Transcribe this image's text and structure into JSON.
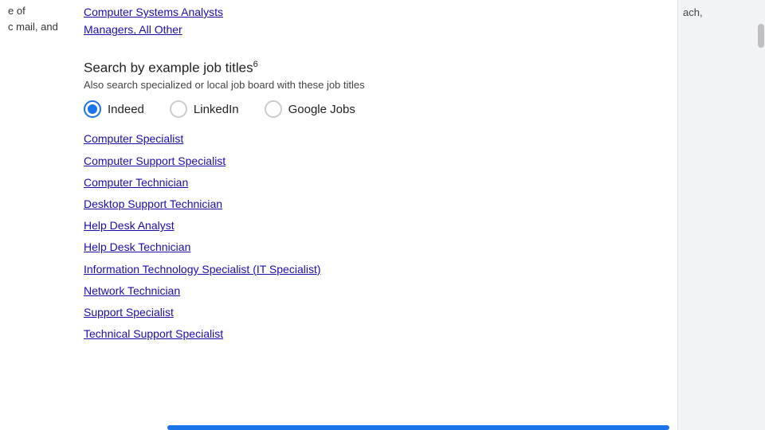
{
  "left": {
    "line1": "e of",
    "line2": "c mail, and"
  },
  "top_links": [
    {
      "label": "Computer Systems Analysts",
      "href": "#"
    },
    {
      "label": "Managers, All Other",
      "href": "#"
    }
  ],
  "search_section": {
    "title": "Search by example job titles",
    "superscript": "6",
    "subtitle": "Also search specialized or local job board with these job titles"
  },
  "radio_options": [
    {
      "label": "Indeed",
      "selected": true
    },
    {
      "label": "LinkedIn",
      "selected": false
    },
    {
      "label": "Google Jobs",
      "selected": false
    }
  ],
  "job_links": [
    {
      "label": "Computer Specialist"
    },
    {
      "label": "Computer Support Specialist"
    },
    {
      "label": "Computer Technician"
    },
    {
      "label": "Desktop Support Technician"
    },
    {
      "label": "Help Desk Analyst"
    },
    {
      "label": "Help Desk Technician"
    },
    {
      "label": "Information Technology Specialist (IT Specialist)"
    },
    {
      "label": "Network Technician"
    },
    {
      "label": "Support Specialist"
    },
    {
      "label": "Technical Support Specialist"
    }
  ],
  "right_sidebar": {
    "text1": "ach,"
  }
}
